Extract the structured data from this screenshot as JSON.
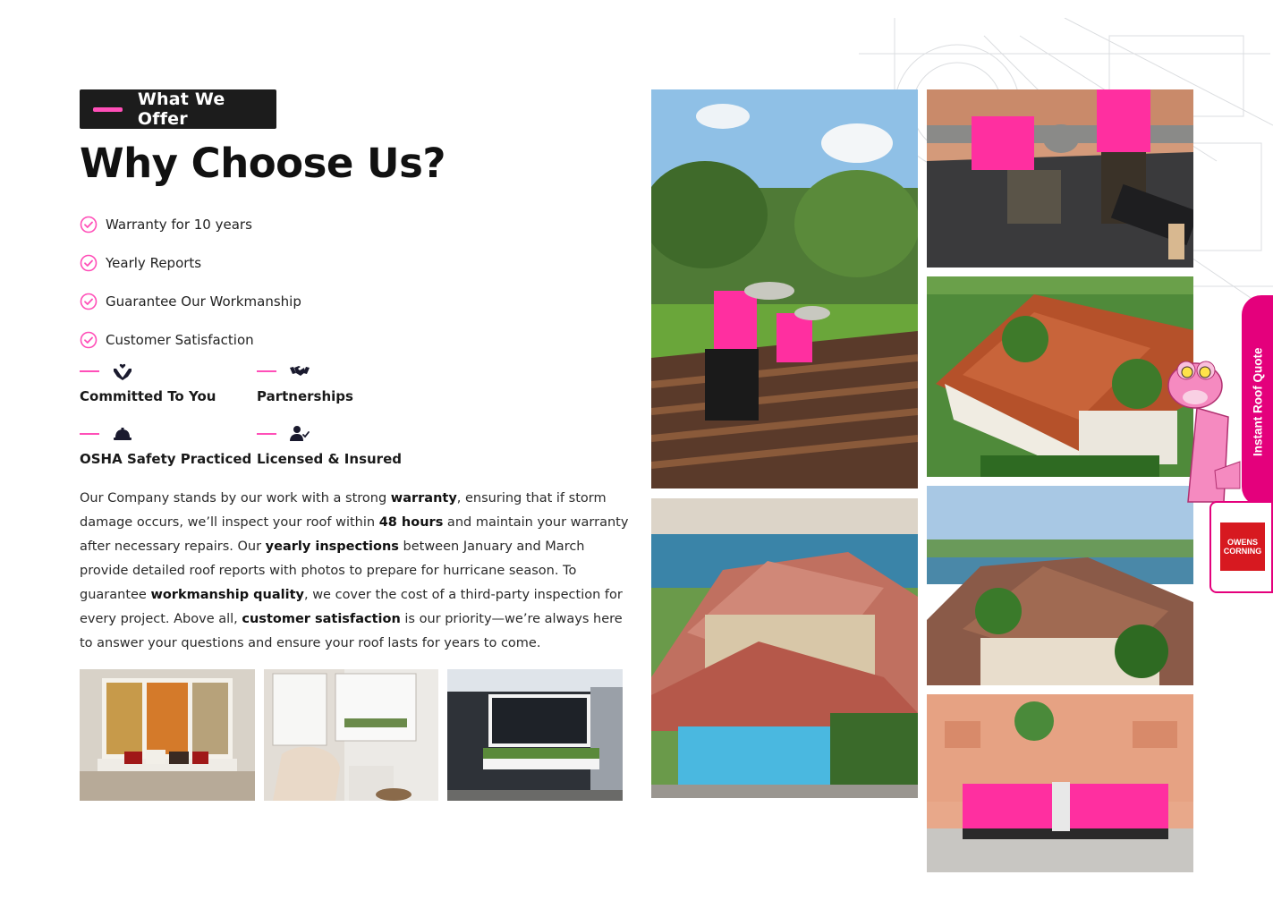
{
  "header": {
    "tag_label": "What We Offer",
    "title": "Why Choose Us?"
  },
  "checklist": [
    {
      "label": "Warranty for 10 years"
    },
    {
      "label": "Yearly Reports"
    },
    {
      "label": "Guarantee Our Workmanship"
    },
    {
      "label": "Customer Satisfaction"
    }
  ],
  "features": [
    {
      "label": "Committed To You",
      "icon": "hands-heart-icon"
    },
    {
      "label": "Partnerships",
      "icon": "handshake-icon"
    },
    {
      "label": "OSHA Safety Practiced",
      "icon": "hard-hat-icon"
    },
    {
      "label": "Licensed & Insured",
      "icon": "user-check-icon"
    }
  ],
  "paragraph": {
    "t1": "Our Company stands by our work with a strong ",
    "b1": "warranty",
    "t2": ", ensuring that if storm damage occurs, we’ll inspect your roof within ",
    "b2": "48 hours",
    "t3": " and maintain your warranty after necessary repairs. Our ",
    "b3": "yearly inspections",
    "t4": " between January and March provide detailed roof reports with photos to prepare for hurricane season. To guarantee ",
    "b4": "workmanship quality",
    "t5": ", we cover the cost of a third-party inspection for every project. Above all, ",
    "b5": "customer satisfaction",
    "t6": " is our priority—we’re always here to answer your questions and ensure your roof lasts for years to come."
  },
  "side_tab": {
    "label": "Instant Roof Quote"
  },
  "logo": {
    "line1": "OWENS",
    "line2": "CORNING"
  },
  "colors": {
    "accent": "#ff4fb8",
    "tab": "#e4007c",
    "dark": "#1c1c1c"
  }
}
